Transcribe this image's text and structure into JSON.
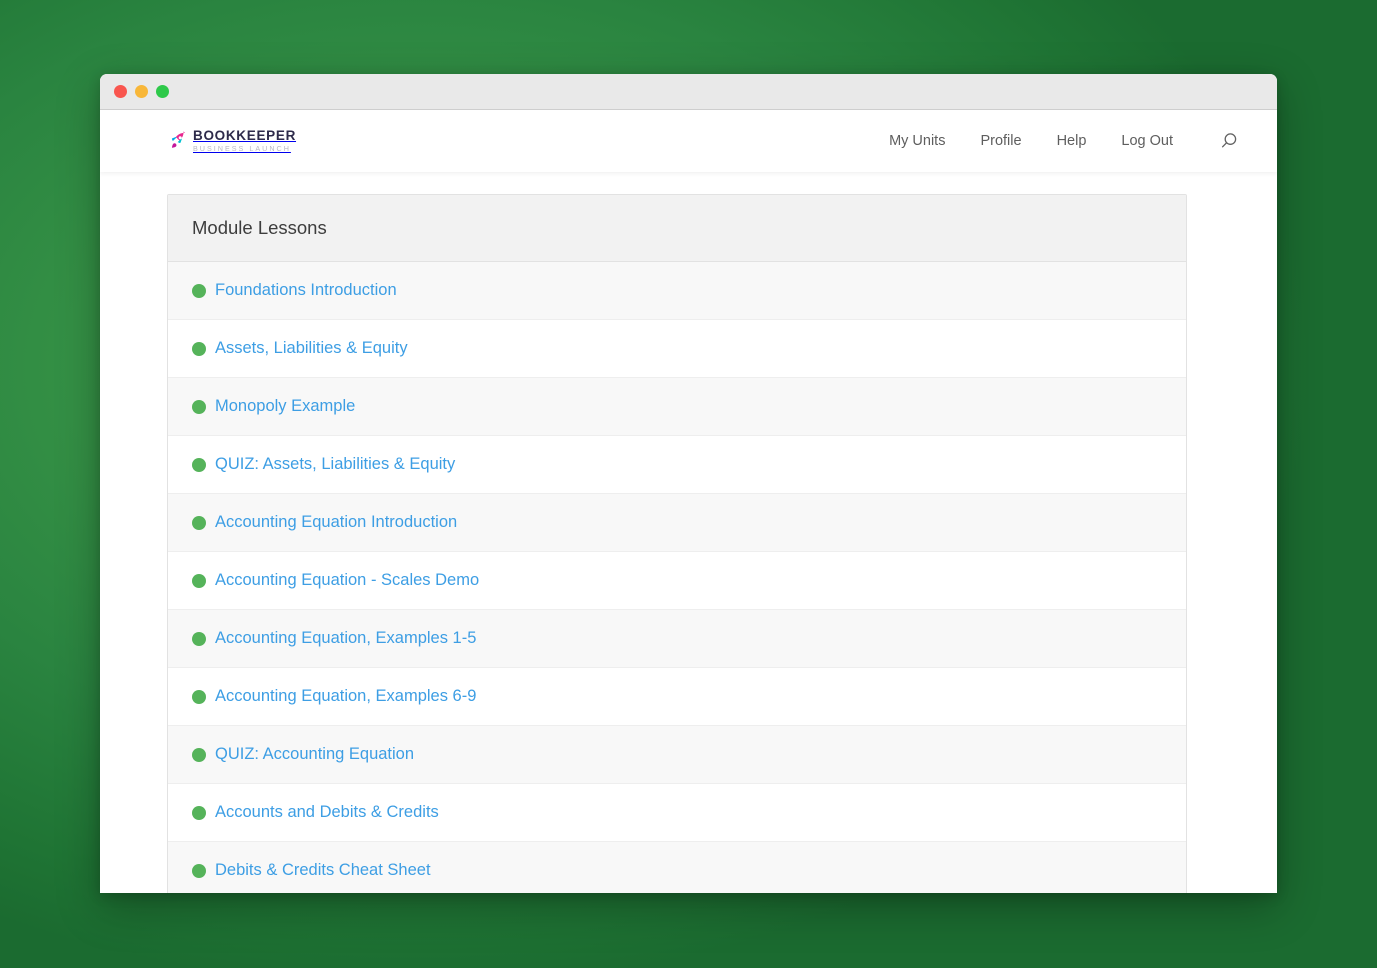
{
  "window": {
    "traffic_lights": [
      {
        "name": "close",
        "color": "#f9564f"
      },
      {
        "name": "minimize",
        "color": "#f8b739"
      },
      {
        "name": "maximize",
        "color": "#2ec94a"
      }
    ]
  },
  "header": {
    "logo": {
      "icon": "rocket-icon",
      "main_text": "BOOKKEEPER",
      "sub_text": "BUSINESS LAUNCH"
    },
    "nav": [
      {
        "label": "My Units"
      },
      {
        "label": "Profile"
      },
      {
        "label": "Help"
      },
      {
        "label": "Log Out"
      }
    ],
    "search_icon": "search-icon"
  },
  "main": {
    "panel_title": "Module Lessons",
    "lessons": [
      {
        "title": "Foundations Introduction",
        "status_color": "#55b35a"
      },
      {
        "title": "Assets, Liabilities & Equity",
        "status_color": "#55b35a"
      },
      {
        "title": "Monopoly Example",
        "status_color": "#55b35a"
      },
      {
        "title": "QUIZ: Assets, Liabilities & Equity",
        "status_color": "#55b35a"
      },
      {
        "title": "Accounting Equation Introduction",
        "status_color": "#55b35a"
      },
      {
        "title": "Accounting Equation - Scales Demo",
        "status_color": "#55b35a"
      },
      {
        "title": "Accounting Equation, Examples 1-5",
        "status_color": "#55b35a"
      },
      {
        "title": "Accounting Equation, Examples 6-9",
        "status_color": "#55b35a"
      },
      {
        "title": "QUIZ: Accounting Equation",
        "status_color": "#55b35a"
      },
      {
        "title": "Accounts and Debits & Credits",
        "status_color": "#55b35a"
      },
      {
        "title": "Debits & Credits Cheat Sheet",
        "status_color": "#55b35a"
      }
    ]
  },
  "colors": {
    "link_blue": "#3d9ee4",
    "status_green": "#55b35a",
    "desktop_green": "#349045",
    "logo_navy": "#2d2a4a"
  }
}
